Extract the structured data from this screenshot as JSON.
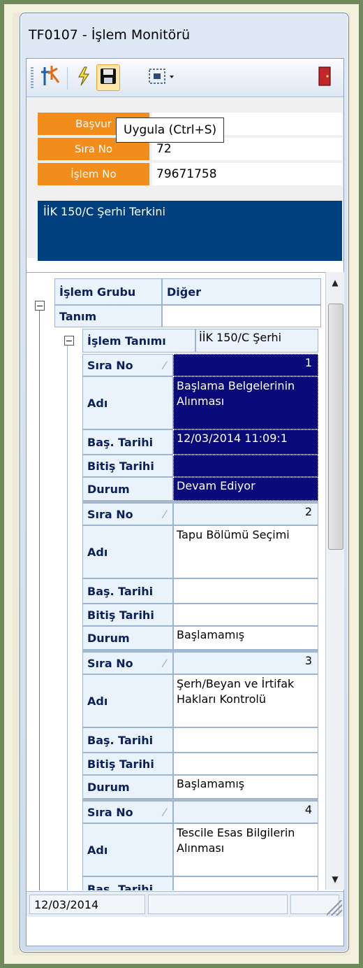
{
  "window": {
    "title": "TF0107 - İşlem Monitörü"
  },
  "toolbar": {
    "tooltip": "Uygula (Ctrl+S)",
    "buttons": [
      {
        "icon": "tk-logo-icon"
      },
      {
        "icon": "lightning-icon"
      },
      {
        "icon": "save-icon"
      },
      {
        "icon": "layout-dropdown-icon"
      },
      {
        "icon": "exit-door-icon"
      }
    ]
  },
  "info": {
    "fields": [
      {
        "label": "Başvuru No",
        "label_visible": "Başvur",
        "value": ""
      },
      {
        "label": "Sıra No",
        "value": "72"
      },
      {
        "label": "İşlem No",
        "value": "79671758"
      }
    ],
    "description": "İİK 150/C Şerhi Terkini"
  },
  "grid": {
    "group": {
      "header": "İşlem Grubu",
      "value": "Diğer"
    },
    "definition": {
      "header": "Tanım",
      "value": ""
    },
    "process_definition": {
      "header": "İşlem Tanımı",
      "value": "İİK 150/C Şerhi"
    },
    "row_headers": {
      "sira_no": "Sıra No",
      "adi": "Adı",
      "bas_tarihi": "Baş. Tarihi",
      "bitis_tarihi": "Bitiş Tarihi",
      "durum": "Durum"
    },
    "sort_glyph": "⁄",
    "records": [
      {
        "sira_no": "1",
        "adi": "Başlama Belgelerinin Alınması",
        "bas_tarihi": "12/03/2014 11:09:1",
        "bitis_tarihi": "",
        "durum": "Devam Ediyor",
        "selected": true
      },
      {
        "sira_no": "2",
        "adi": "Tapu Bölümü Seçimi",
        "bas_tarihi": "",
        "bitis_tarihi": "",
        "durum": "Başlamamış",
        "selected": false
      },
      {
        "sira_no": "3",
        "adi": "Şerh/Beyan ve İrtifak Hakları Kontrolü",
        "bas_tarihi": "",
        "bitis_tarihi": "",
        "durum": "Başlamamış",
        "selected": false
      },
      {
        "sira_no": "4",
        "adi": "Tescile Esas Bilgilerin Alınması",
        "bas_tarihi": "",
        "bitis_tarihi": "",
        "durum": "",
        "selected": false
      }
    ]
  },
  "status": {
    "date": "12/03/2014"
  }
}
